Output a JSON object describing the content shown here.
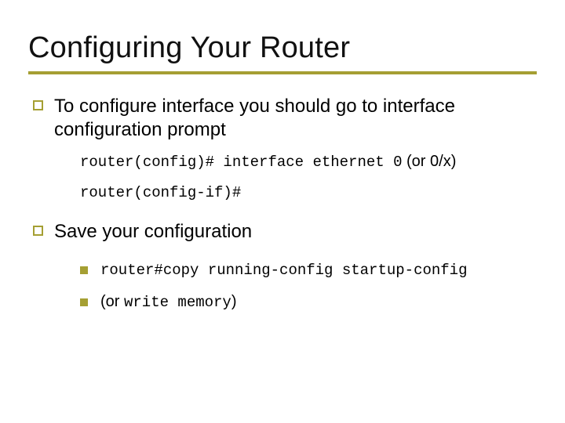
{
  "title": "Configuring Your Router",
  "b1": "To configure interface you should go to interface configuration prompt",
  "code1_mono": "router(config)# interface ethernet 0",
  "code1_tail": " (or 0/x)",
  "code2": "router(config-if)#",
  "b2": "Save your configuration",
  "sub1": "router#copy running-config startup-config",
  "sub2_prefix": "(or ",
  "sub2_mono": "write memory",
  "sub2_suffix": ")"
}
